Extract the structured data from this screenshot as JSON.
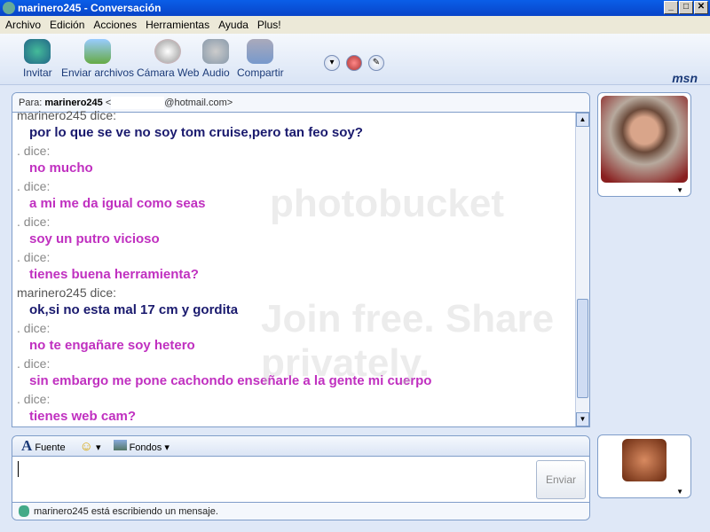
{
  "window": {
    "title": "marinero245 - Conversación",
    "min": "_",
    "max": "□",
    "close": "✕"
  },
  "menu": [
    "Archivo",
    "Edición",
    "Acciones",
    "Herramientas",
    "Ayuda",
    "Plus!"
  ],
  "toolbar": {
    "items": [
      "Invitar",
      "Enviar archivos",
      "Cámara Web",
      "Audio",
      "Compartir"
    ],
    "brand": "msn"
  },
  "to": {
    "label": "Para:",
    "name": "marinero245",
    "email_start": "<",
    "email_end": "@hotmail.com>"
  },
  "messages": [
    {
      "sender": "marinero245 dice:",
      "text": "por lo que se ve no soy tom cruise,pero tan feo soy?",
      "me": true
    },
    {
      "sender": ". dice:",
      "text": "no mucho",
      "me": false
    },
    {
      "sender": ". dice:",
      "text": "a mi me da igual como seas",
      "me": false
    },
    {
      "sender": ". dice:",
      "text": "soy un putro vicioso",
      "me": false
    },
    {
      "sender": ". dice:",
      "text": "tienes buena herramienta?",
      "me": false
    },
    {
      "sender": "marinero245 dice:",
      "text": "ok,si no esta mal 17 cm y gordita",
      "me": true
    },
    {
      "sender": ". dice:",
      "text": "no te engañare soy hetero",
      "me": false
    },
    {
      "sender": ". dice:",
      "text": "sin embargo me pone cachondo enseñarle a la gente mi cuerpo",
      "me": false
    },
    {
      "sender": ". dice:",
      "text": "tienes web cam?",
      "me": false
    }
  ],
  "colors": {
    "me": "#1a1a6e",
    "other": "#c030c0"
  },
  "format": {
    "font": "Fuente",
    "backgrounds": "Fondos"
  },
  "input": {
    "value": "",
    "send": "Enviar"
  },
  "status": "marinero245 está escribiendo un mensaje.",
  "watermark": {
    "brand": "photobucket",
    "tagline": "Join free. Share privately."
  }
}
